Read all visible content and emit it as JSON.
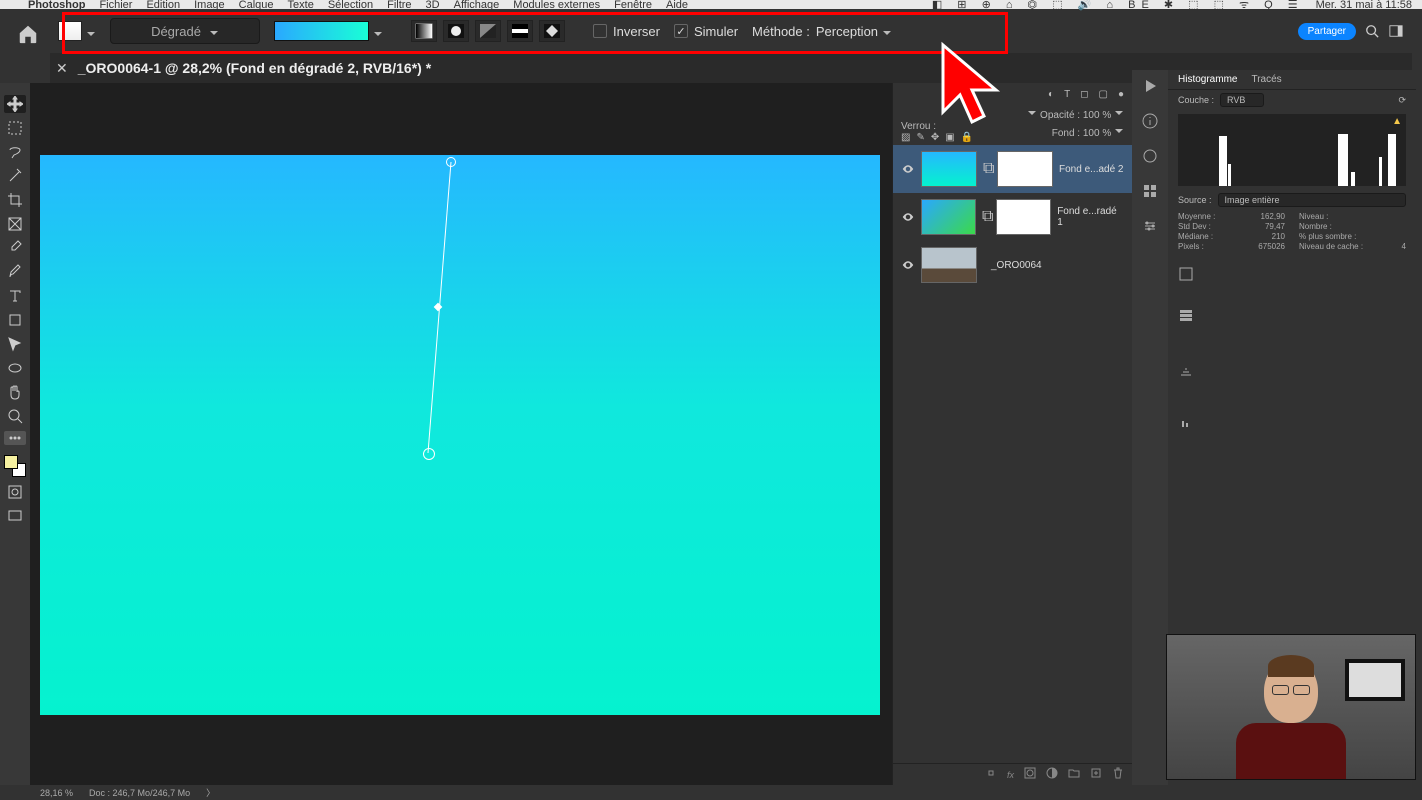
{
  "mac_menu": {
    "app": "Photoshop",
    "items": [
      "Fichier",
      "Édition",
      "Image",
      "Calque",
      "Texte",
      "Sélection",
      "Filtre",
      "3D",
      "Affichage",
      "Modules externes",
      "Fenêtre",
      "Aide"
    ],
    "clock": "Mer. 31 mai à 11:58"
  },
  "options_bar": {
    "preset_label": "Dégradé",
    "inverser_label": "Inverser",
    "inverser_checked": false,
    "simuler_label": "Simuler",
    "simuler_checked": true,
    "method_label": "Méthode :",
    "method_value": "Perception",
    "share_label": "Partager"
  },
  "tab": {
    "title": "_ORO0064-1 @ 28,2% (Fond en dégradé 2, RVB/16*) *"
  },
  "layers": {
    "verrou_label": "Verrou :",
    "opacity_label": "Opacité :",
    "opacity_value": "100 %",
    "fond_label": "Fond :",
    "fond_value": "100 %",
    "items": [
      {
        "name": "Fond e...adé 2",
        "thumb": "grad1",
        "selected": true
      },
      {
        "name": "Fond e...radé 1",
        "thumb": "grad2",
        "selected": false
      },
      {
        "name": "_ORO0064",
        "thumb": "photo",
        "selected": false,
        "nomask": true
      }
    ]
  },
  "histogram": {
    "tab1": "Histogramme",
    "tab2": "Tracés",
    "couche_label": "Couche :",
    "couche_value": "RVB",
    "source_label": "Source :",
    "source_value": "Image entière",
    "stats": {
      "moyenne_l": "Moyenne :",
      "moyenne_v": "162,90",
      "niveau_l": "Niveau :",
      "niveau_v": "",
      "stddev_l": "Std Dev :",
      "stddev_v": "79,47",
      "nombre_l": "Nombre :",
      "nombre_v": "",
      "mediane_l": "Médiane :",
      "mediane_v": "210",
      "plus_l": "% plus sombre :",
      "plus_v": "",
      "pixels_l": "Pixels :",
      "pixels_v": "675026",
      "cache_l": "Niveau de cache :",
      "cache_v": "4"
    }
  },
  "status": {
    "zoom": "28,16 %",
    "doc": "Doc : 246,7 Mo/246,7 Mo"
  },
  "layer_opts_icons": [
    "adjust",
    "text",
    "crop",
    "mask",
    "dot"
  ]
}
